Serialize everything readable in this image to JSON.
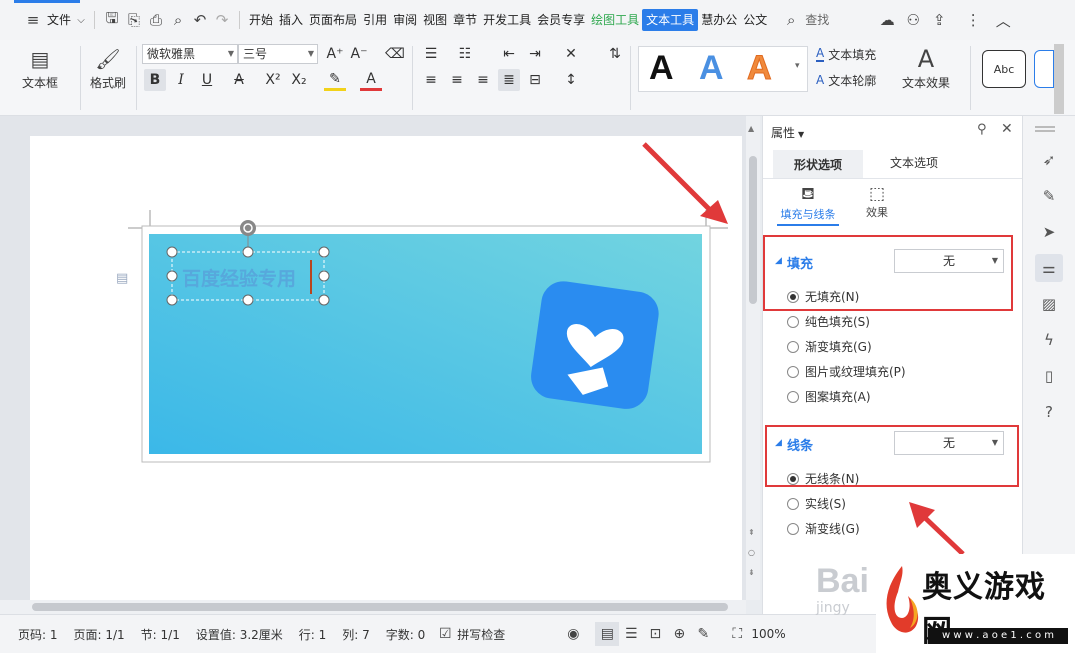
{
  "menu": {
    "file": "文件",
    "tabs": [
      "开始",
      "插入",
      "页面布局",
      "引用",
      "审阅",
      "视图",
      "章节",
      "开发工具",
      "会员专享"
    ],
    "draw_tools": "绘图工具",
    "text_tools": "文本工具",
    "after_tabs": [
      "慧办公",
      "公文"
    ],
    "search": "查找"
  },
  "ribbon": {
    "textbox": "文本框",
    "format_painter": "格式刷",
    "font_name": "微软雅黑",
    "font_size": "三号",
    "art_letter": "A",
    "abc": "Abc",
    "text_fill": "文本填充",
    "text_outline": "文本轮廓",
    "text_effect": "文本效果"
  },
  "document": {
    "textbox_text": "百度经验专用"
  },
  "panel": {
    "title": "属性",
    "tab_shape": "形状选项",
    "tab_text": "文本选项",
    "sub_fill_line": "填充与线条",
    "sub_effect": "效果",
    "fill": {
      "title": "填充",
      "value": "无",
      "options": [
        "无填充(N)",
        "纯色填充(S)",
        "渐变填充(G)",
        "图片或纹理填充(P)",
        "图案填充(A)"
      ],
      "selected": 0
    },
    "line": {
      "title": "线条",
      "value": "无",
      "options": [
        "无线条(N)",
        "实线(S)",
        "渐变线(G)"
      ],
      "selected": 0
    }
  },
  "status": {
    "page_code": "页码: 1",
    "page": "页面: 1/1",
    "section": "节: 1/1",
    "position": "设置值: 3.2厘米",
    "row": "行: 1",
    "col": "列: 7",
    "words": "字数: 0",
    "spellcheck": "拼写检查",
    "zoom": "100%"
  },
  "watermark": {
    "brand": "奥义游戏网",
    "url": "w w w . a o e 1 . c o m",
    "baidu": "Bai",
    "jingyan": "jingy"
  },
  "colors": {
    "accent": "#2b7de9",
    "banner_start": "#3bb8e8",
    "banner_end": "#72d4e0",
    "highlight": "#e0393a"
  }
}
